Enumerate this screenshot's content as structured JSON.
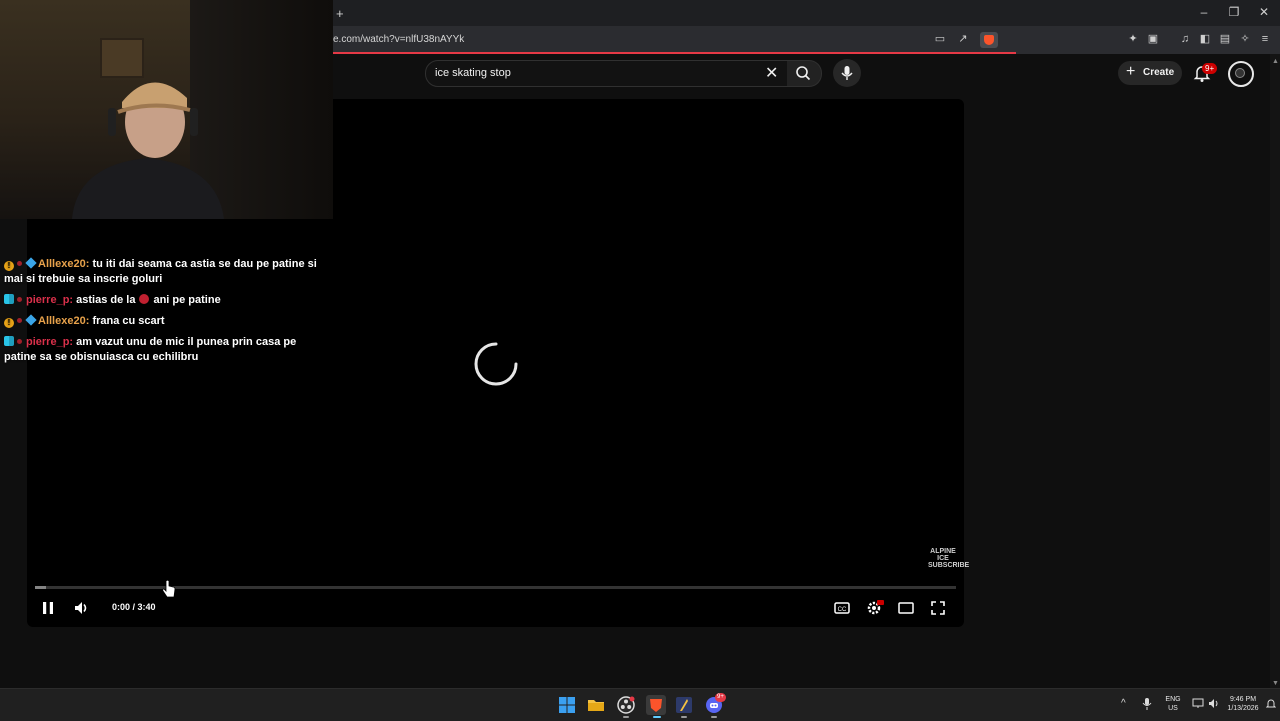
{
  "browser": {
    "new_tab_symbol": "+",
    "url": "e.com/watch?v=nlfU38nAYYk",
    "window_controls": [
      "–",
      "❐",
      "✕"
    ]
  },
  "youtube": {
    "search": {
      "value": "ice skating stop"
    },
    "create_label": "Create",
    "notifications_badge": "9+"
  },
  "player": {
    "time_display": "0:00 / 3:40",
    "watermark": "ALPINE ICE SUBSCRIBE",
    "progress_loaded_fraction": 0.012,
    "settings_badge": "HD"
  },
  "chat": [
    {
      "user": "Alllexe20:",
      "user_color": "#e8a24b",
      "message": "tu iti dai seama ca astia se dau pe patine si mai si trebuie sa inscrie goluri"
    },
    {
      "user": "pierre_p:",
      "user_color": "#d9304a",
      "message_before": "astias de la",
      "message_after": "ani pe patine"
    },
    {
      "user": "Alllexe20:",
      "user_color": "#e8a24b",
      "message": "frana cu scart"
    },
    {
      "user": "pierre_p:",
      "user_color": "#d9304a",
      "message": "am vazut unu de mic il punea prin casa pe patine sa se obisnuiasca cu echilibru"
    }
  ],
  "taskbar": {
    "discord_badge": "9+",
    "lang_line1": "ENG",
    "lang_line2": "US",
    "time": "9:46 PM",
    "date": "1/13/2026"
  }
}
